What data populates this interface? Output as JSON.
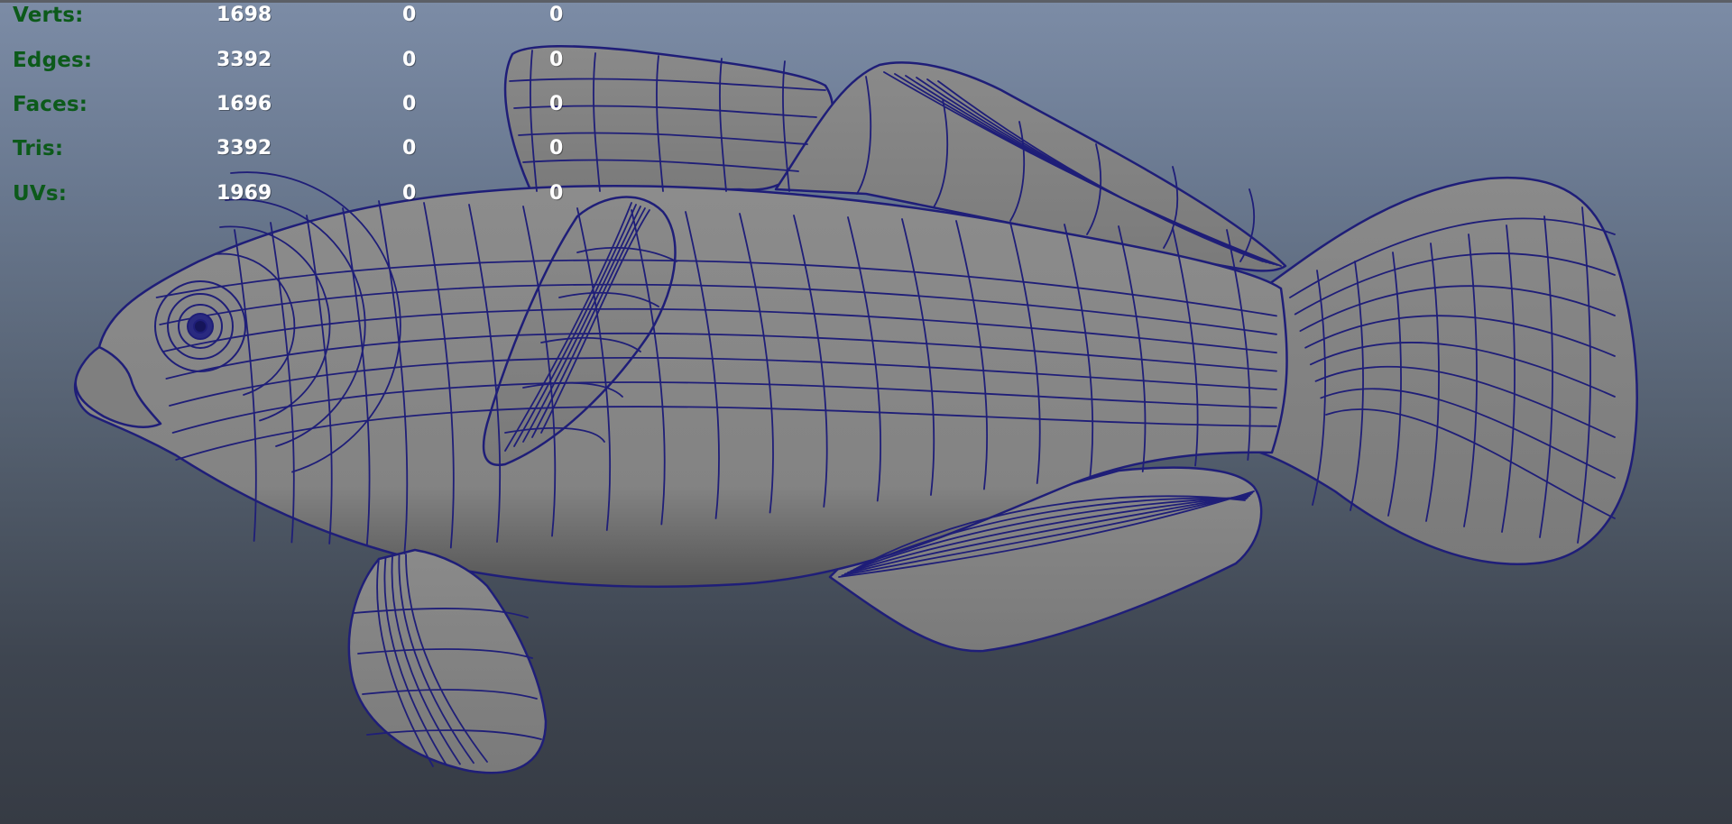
{
  "hud": {
    "stats": [
      {
        "label": "Verts:",
        "values": [
          "1698",
          "0",
          "0"
        ]
      },
      {
        "label": "Edges:",
        "values": [
          "3392",
          "0",
          "0"
        ]
      },
      {
        "label": "Faces:",
        "values": [
          "1696",
          "0",
          "0"
        ]
      },
      {
        "label": "Tris:",
        "values": [
          "3392",
          "0",
          "0"
        ]
      },
      {
        "label": "UVs:",
        "values": [
          "1969",
          "0",
          "0"
        ]
      }
    ],
    "label_color": "#0c5a1a",
    "value_color": "#ffffff"
  },
  "scene": {
    "wire_color": "#1f1e78",
    "shade_color": "#848484",
    "background_top": "#7c8ca6",
    "background_bottom": "#363b44"
  }
}
